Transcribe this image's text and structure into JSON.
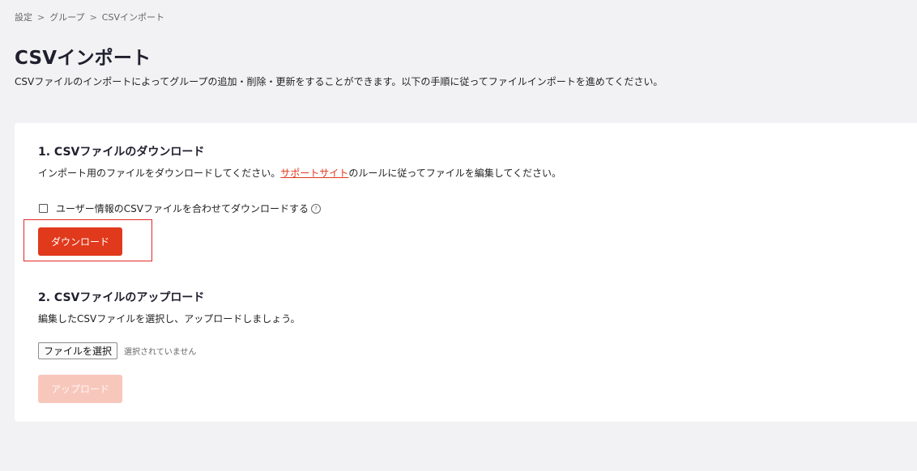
{
  "breadcrumb": {
    "items": [
      "設定",
      "グループ",
      "CSVインポート"
    ],
    "separator": ">"
  },
  "page": {
    "title": "CSVインポート",
    "description": "CSVファイルのインポートによってグループの追加・削除・更新をすることができます。以下の手順に従ってファイルインポートを進めてください。"
  },
  "download_section": {
    "heading": "1. CSVファイルのダウンロード",
    "text_before_link": "インポート用のファイルをダウンロードしてください。",
    "link_label": "サポートサイト",
    "text_after_link": "のルールに従ってファイルを編集してください。",
    "checkbox_label": "ユーザー情報のCSVファイルを合わせてダウンロードする",
    "checkbox_checked": false,
    "help_icon": "?",
    "button_label": "ダウンロード"
  },
  "upload_section": {
    "heading": "2. CSVファイルのアップロード",
    "text": "編集したCSVファイルを選択し、アップロードしましょう。",
    "file_button_label": "ファイルを選択",
    "file_status": "選択されていません",
    "button_label": "アップロード",
    "button_disabled": true
  },
  "colors": {
    "accent": "#e0391c",
    "accent_disabled": "#f8c7bc",
    "highlight": "#e02a2a",
    "background": "#f2f2f4",
    "card": "#ffffff"
  }
}
